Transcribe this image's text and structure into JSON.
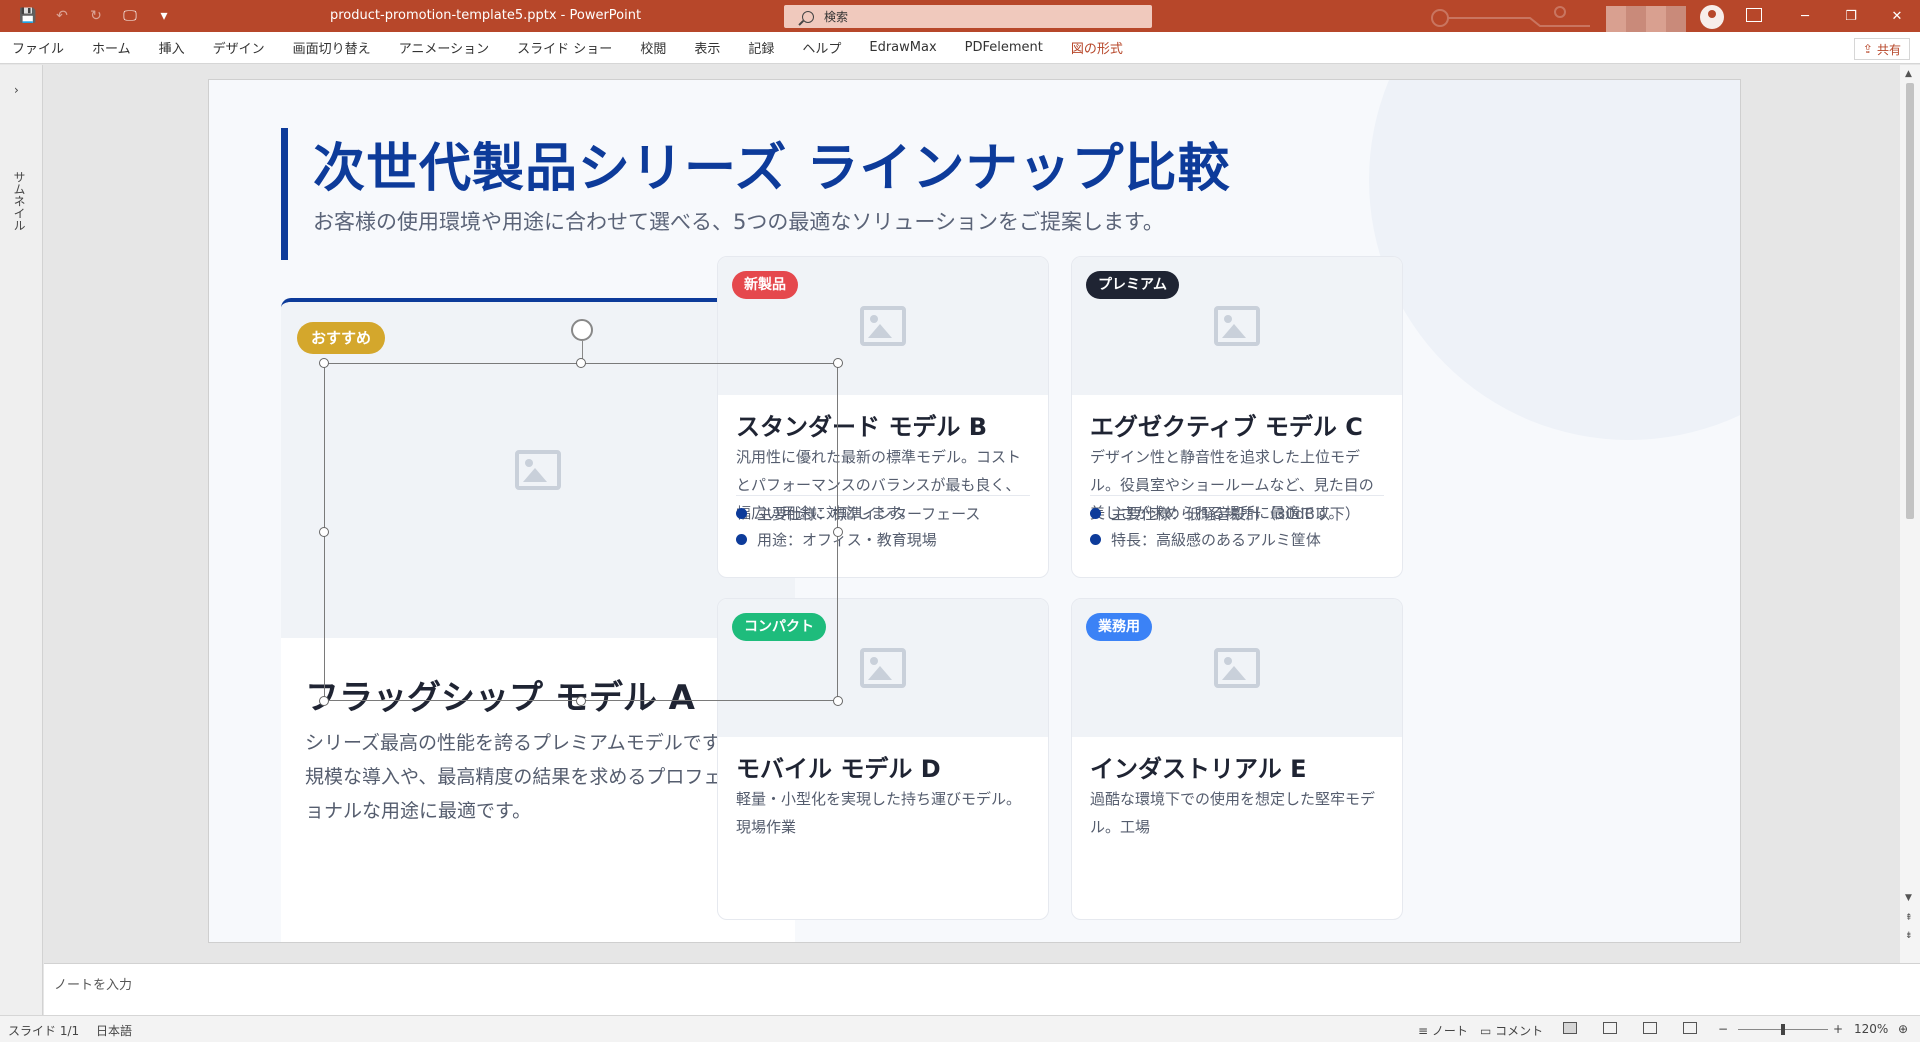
{
  "titlebar": {
    "doc_title": "product-promotion-template5.pptx  -  PowerPoint",
    "search_placeholder": "検索",
    "minimize": "─",
    "restore": "❐",
    "close": "✕",
    "qat_save": "💾",
    "qat_undo": "↶",
    "qat_redo": "↻",
    "qat_present": "🖵",
    "qat_more": "▾"
  },
  "menu": {
    "items": [
      "ファイル",
      "ホーム",
      "挿入",
      "デザイン",
      "画面切り替え",
      "アニメーション",
      "スライド ショー",
      "校閲",
      "表示",
      "記録",
      "ヘルプ",
      "EdrawMax",
      "PDFelement",
      "図の形式"
    ],
    "share": "共有"
  },
  "thumbnails": {
    "toggle": "›",
    "label": "サムネイル"
  },
  "slide": {
    "title": "次世代製品シリーズ ラインナップ比較",
    "subtitle": "お客様の使用環境や用途に合わせて選べる、5つの最適なソリューションをご提案します。",
    "featured": {
      "badge": "おすすめ",
      "badge_color": "#d4a72c",
      "title": "フラッグシップ モデル A",
      "desc": "シリーズ最高の性能を誇るプレミアムモデルです。大規模な導入や、最高精度の結果を求めるプロフェッショナルな用途に最適です。"
    },
    "cards": [
      {
        "badge": "新製品",
        "badge_color": "#e5484d",
        "title": "スタンダード モデル B",
        "desc": "汎用性に優れた最新の標準モデル。コストとパフォーマンスのバランスが最も良く、幅広い用途に対応します。",
        "spec1": "主要仕様：標準インターフェース",
        "spec2": "用途：オフィス・教育現場"
      },
      {
        "badge": "プレミアム",
        "badge_color": "#1f2433",
        "title": "エグゼクティブ モデル C",
        "desc": "デザイン性と静音性を追求した上位モデル。役員室やショールームなど、見た目の美しさが求められる場所に最適です。",
        "spec1": "主要仕様：低騒音設計（30dB以下）",
        "spec2": "特長：高級感のあるアルミ筐体"
      },
      {
        "badge": "コンパクト",
        "badge_color": "#1ebc7c",
        "title": "モバイル モデル D",
        "desc": "軽量・小型化を実現した持ち運びモデル。現場作業"
      },
      {
        "badge": "業務用",
        "badge_color": "#3b82f6",
        "title": "インダストリアル E",
        "desc": "過酷な環境下での使用を想定した堅牢モデル。工場"
      }
    ]
  },
  "notes": {
    "placeholder": "ノートを入力"
  },
  "status": {
    "slide": "スライド 1/1",
    "language": "日本語",
    "notes": "ノート",
    "comments": "コメント",
    "zoom": "120%",
    "zoom_minus": "−",
    "zoom_plus": "+"
  }
}
